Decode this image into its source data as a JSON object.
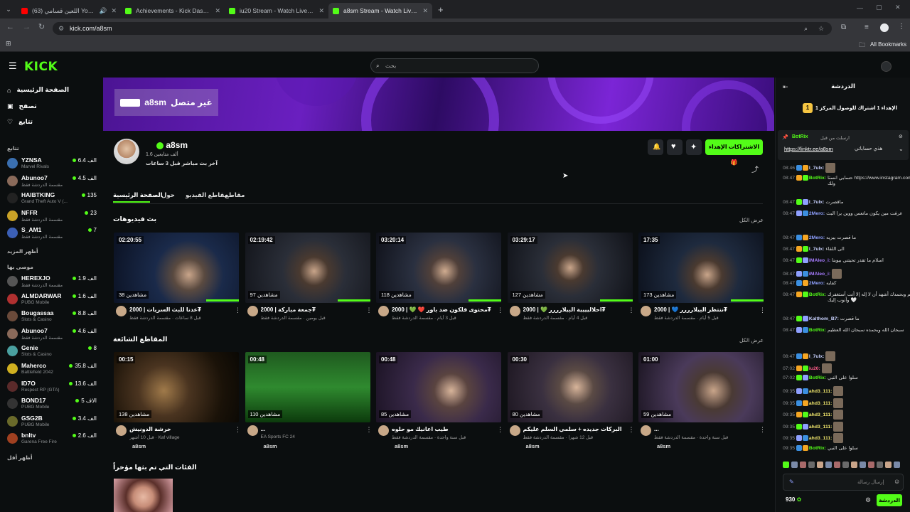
{
  "browser": {
    "tabs": [
      {
        "title": "(63) اللعين قسامي YouTube",
        "icon": "youtube-icon",
        "active": false
      },
      {
        "title": "Achievements - Kick Dashboard",
        "icon": "kick-icon",
        "active": false
      },
      {
        "title": "iu20 Stream - Watch Live on Ki",
        "icon": "kick-icon",
        "active": false
      },
      {
        "title": "a8sm Stream - Watch Live on K",
        "icon": "kick-icon",
        "active": true
      }
    ],
    "url": "kick.com/a8sm",
    "bookmarks_label": "All Bookmarks"
  },
  "header": {
    "logo": "KICK",
    "search_placeholder": "بحث"
  },
  "sidebar": {
    "nav": [
      {
        "label": "الصفحة الرئيسية",
        "icon": "home-icon"
      },
      {
        "label": "تصفح",
        "icon": "browse-icon"
      },
      {
        "label": "تتابع",
        "icon": "heart-icon"
      }
    ],
    "following_title": "تتابع",
    "following": [
      {
        "name": "YZNSA",
        "game": "Marvel Rivals",
        "viewers": "6.4 الف"
      },
      {
        "name": "Abunoo7",
        "game": "مقسمة الدردشة فقط",
        "viewers": "4.5 الف"
      },
      {
        "name": "HAIBTKING",
        "game": "Grand Theft Auto V (...",
        "viewers": "135"
      },
      {
        "name": "NFFR",
        "game": "مقسمة الدردشة فقط",
        "viewers": "23"
      },
      {
        "name": "S_AM1",
        "game": "مقسمة الدردشة فقط",
        "viewers": "7"
      }
    ],
    "show_more": "أظهر المزيد",
    "recommended_title": "موصى بها",
    "recommended": [
      {
        "name": "HEREXJO",
        "game": "مقسمة الدردشة فقط",
        "viewers": "1.9 الف"
      },
      {
        "name": "ALMDARWAR",
        "game": "PUBG Mobile",
        "viewers": "1.6 الف"
      },
      {
        "name": "Bougassaa",
        "game": "Slots & Casino",
        "viewers": "8.8 الف"
      },
      {
        "name": "Abunoo7",
        "game": "مقسمة الدردشة فقط",
        "viewers": "4.6 الف"
      },
      {
        "name": "Genie",
        "game": "Slots & Casino",
        "viewers": "8"
      },
      {
        "name": "Maherco",
        "game": "Battlefield 2042",
        "viewers": "35.8 الف"
      },
      {
        "name": "ID7O",
        "game": "Respect RP (GTA)",
        "viewers": "13.6 الف"
      },
      {
        "name": "BOND17",
        "game": "PUBG Mobile",
        "viewers": "5 الاف"
      },
      {
        "name": "GSG2B",
        "game": "PUBG Mobile",
        "viewers": "3.4 الف"
      },
      {
        "name": "bnltv",
        "game": "Garena Free Fire",
        "viewers": "2.6 الف"
      }
    ],
    "show_less": "أظهر أقل"
  },
  "channel": {
    "offline_text": "غير متصل",
    "name": "a8sm",
    "followers": "1.6 ألف متابعين",
    "last_live": "آخر بث مباشر قبل 3 ساعات",
    "subscribe_label": "الاشتراكات الإهداء",
    "tabs": [
      "الصفحة الرئيسية",
      "حول",
      "مقاطع الفيديو",
      "مقاطع"
    ],
    "vods_title": "بث فيديوهات",
    "view_all": "عرض الكل",
    "vods": [
      {
        "duration": "02:20:55",
        "views": "38 مشاهدين",
        "title": "عدنا للبث السريات | 2000₮",
        "meta": "قبل 8 ساعات · مقسمة الدردشة فقط"
      },
      {
        "duration": "02:19:42",
        "views": "97 مشاهدين",
        "title": "جمعة مباركة | 2000₮",
        "meta": "قبل يومين · مقسمة الدردشة فقط"
      },
      {
        "duration": "03:20:14",
        "views": "118 مشاهدين",
        "title": "محتوى قلكون ضد باور ❤️ 💚 | 2000₮",
        "meta": "قبل 3 أيام · مقسمة الدردشة فقط"
      },
      {
        "duration": "03:29:17",
        "views": "127 مشاهدين",
        "title": "احلاليييية البيلارررر 💚 | 2000₮",
        "meta": "قبل 4 أيام · مقسمة الدردشة فقط"
      },
      {
        "duration": "17:35",
        "views": "173 مشاهدين",
        "title": "ننتظر البيلارررر 💙 | 2000₮",
        "meta": "قبل 5 أيام · مقسمة الدردشة فقط"
      }
    ],
    "clips_title": "المقاطع الشائعة",
    "clips": [
      {
        "duration": "00:15",
        "views": "138 مشاهدين",
        "title": "خرشة الدونيش",
        "meta": "قبل 10 أشهر · Kaf village",
        "author": "a8sm"
      },
      {
        "duration": "00:48",
        "views": "110 مشاهدين",
        "title": "...",
        "meta": "EA Sports FC 24",
        "author": "a8sm"
      },
      {
        "duration": "00:48",
        "views": "85 مشاهدين",
        "title": "طيب اعانيك مو حلوه",
        "meta": "قبل سنة واحدة · مقسمة الدردشة فقط",
        "author": "a8sm"
      },
      {
        "duration": "00:30",
        "views": "80 مشاهدين",
        "title": "البركات جديده + سلمي السلم عليكم ... 💙 💙",
        "meta": "قبل 12 شهرا · مقسمة الدردشة فقط",
        "author": "a8sm"
      },
      {
        "duration": "01:00",
        "views": "59 مشاهدين",
        "title": "...",
        "meta": "قبل سنة واحدة · مقسمة الدردشة فقط",
        "author": "a8sm"
      }
    ],
    "recent_title": "الفئات التي تم بثها مؤخراً"
  },
  "chat": {
    "title": "الدردشة",
    "gift_goal": "الإهداء 1 اشتراك للوصول المركز 1",
    "gift_rank": "1",
    "pinned": {
      "user": "BotRix",
      "time": "ارسلت من قبل",
      "text": "هذي حساباتي",
      "link": "https://linktr.ee/a8sm"
    },
    "messages": [
      {
        "time": "08:46",
        "user": "l_7ulx:",
        "text": "",
        "color": "#c9d2ff"
      },
      {
        "time": "08:47",
        "user": "BotRix:",
        "text": "حسابي انستا https://www.instagram.com/a8sm/ وانشرني ولك",
        "color": "#53fc18"
      },
      {
        "time": "08:47",
        "user": "l_7ulx:",
        "text": "ماقصرت",
        "color": "#c9d2ff"
      },
      {
        "time": "08:47",
        "user": "2Mero:",
        "text": "عرفت مين يكون مانعس ووين يرا البث",
        "color": "#8fa0ff"
      },
      {
        "time": "08:47",
        "user": "2Mero:",
        "text": "ما قصرت يبزيه",
        "color": "#8fa0ff"
      },
      {
        "time": "08:47",
        "user": "l_7ulx:",
        "text": "الى اللقاء",
        "color": "#c9d2ff"
      },
      {
        "time": "08:47",
        "user": "iMAleo_i:",
        "text": "اسلام ما تقدر تحيتني بيوبنا",
        "color": "#a87cff"
      },
      {
        "time": "08:47",
        "user": "iMAleo_i:",
        "text": "",
        "color": "#a87cff"
      },
      {
        "time": "08:47",
        "user": "2Mero:",
        "text": "كفايه",
        "color": "#8fa0ff"
      },
      {
        "time": "08:47",
        "user": "BotRix:",
        "text": "سبحانك اللهم وبحمدك أشهد أن لا إله إلا أنت أستغفرك وأتوب إليك 🤍",
        "color": "#53fc18"
      },
      {
        "time": "08:47",
        "user": "Kalthom_B7:",
        "text": "ما قصرت",
        "color": "#c9d2ff"
      },
      {
        "time": "08:47",
        "user": "BotRix:",
        "text": "سبحان الله وبحمده سبحان الله العظيم",
        "color": "#53fc18"
      },
      {
        "time": "08:47",
        "user": "l_7ulx:",
        "text": "",
        "color": "#c9d2ff"
      },
      {
        "time": "07:02",
        "user": "iu20:",
        "text": "",
        "color": "#ff5c8a"
      },
      {
        "time": "07:02",
        "user": "BotRix:",
        "text": "سلوا على النبي",
        "color": "#53fc18"
      },
      {
        "time": "09:35",
        "user": "ahd3_111:",
        "text": "",
        "color": "#f2e86d"
      },
      {
        "time": "09:35",
        "user": "ahd3_111:",
        "text": "",
        "color": "#f2e86d"
      },
      {
        "time": "09:35",
        "user": "ahd3_111:",
        "text": "",
        "color": "#f2e86d"
      },
      {
        "time": "09:35",
        "user": "ahd3_111:",
        "text": "",
        "color": "#f2e86d"
      },
      {
        "time": "09:35",
        "user": "ahd3_111:",
        "text": "",
        "color": "#f2e86d"
      },
      {
        "time": "09:35",
        "user": "BotRix:",
        "text": "سلوا على النبي",
        "color": "#53fc18"
      }
    ],
    "input_placeholder": "إرسال رسالة",
    "points": "930",
    "send_label": "الدردشة"
  },
  "colors": {
    "accent": "#53fc18",
    "bg": "#0b0e0f"
  }
}
